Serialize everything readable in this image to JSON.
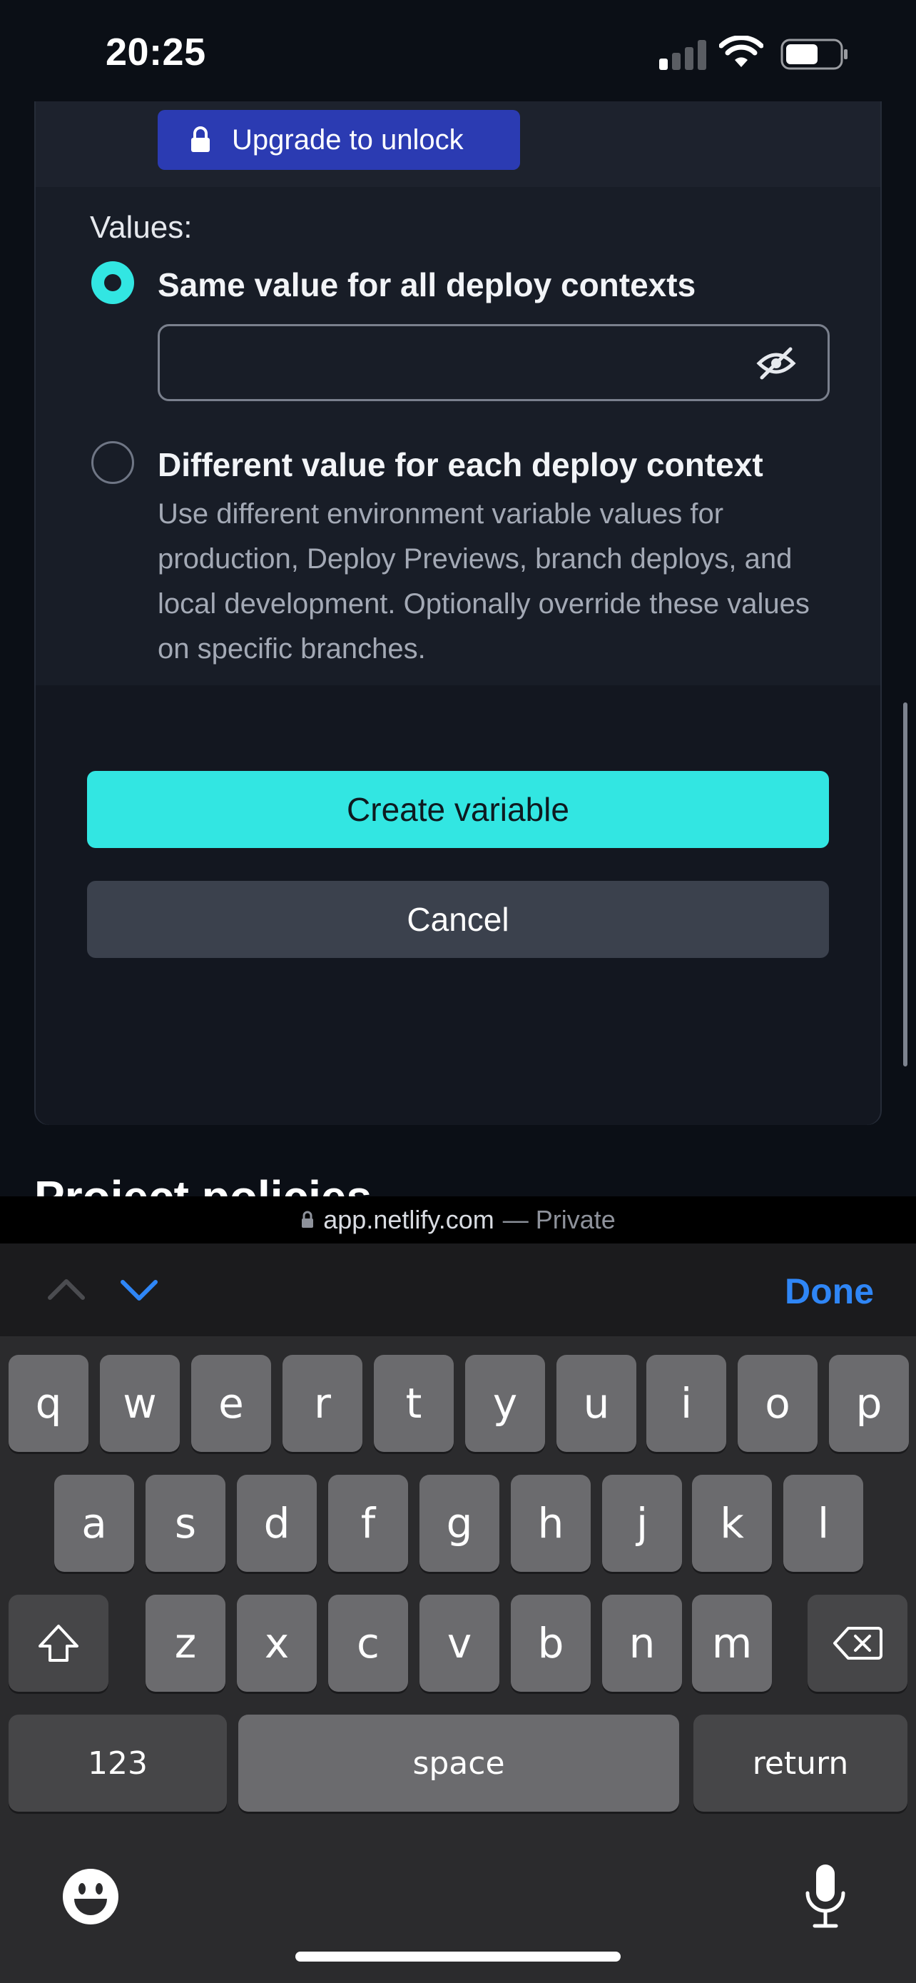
{
  "status_bar": {
    "time": "20:25"
  },
  "upgrade": {
    "label": "Upgrade to unlock"
  },
  "values": {
    "heading": "Values:",
    "option_same": {
      "label": "Same value for all deploy contexts",
      "selected": true,
      "input_value": ""
    },
    "option_different": {
      "label": "Different value for each deploy context",
      "description": "Use different environment variable values for production, Deploy Previews, branch deploys, and local development. Optionally override these values on specific branches.",
      "selected": false
    }
  },
  "actions": {
    "create_label": "Create variable",
    "cancel_label": "Cancel"
  },
  "next_section": {
    "title": "Project policies"
  },
  "browser": {
    "host": "app.netlify.com",
    "private_label": "— Private"
  },
  "keyboard_accessory": {
    "done_label": "Done"
  },
  "keyboard": {
    "row1": [
      "q",
      "w",
      "e",
      "r",
      "t",
      "y",
      "u",
      "i",
      "o",
      "p"
    ],
    "row2": [
      "a",
      "s",
      "d",
      "f",
      "g",
      "h",
      "j",
      "k",
      "l"
    ],
    "row3": [
      "z",
      "x",
      "c",
      "v",
      "b",
      "n",
      "m"
    ],
    "numbers_label": "123",
    "space_label": "space",
    "return_label": "return"
  },
  "colors": {
    "accent": "#32e6e2",
    "upgrade": "#2b3bb2",
    "card": "#181d27",
    "ios_blue": "#2f86f6"
  },
  "icons": [
    "lock-icon",
    "eye-off-icon",
    "chevron-up-icon",
    "chevron-down-icon",
    "shift-icon",
    "backspace-icon",
    "emoji-icon",
    "microphone-icon"
  ]
}
